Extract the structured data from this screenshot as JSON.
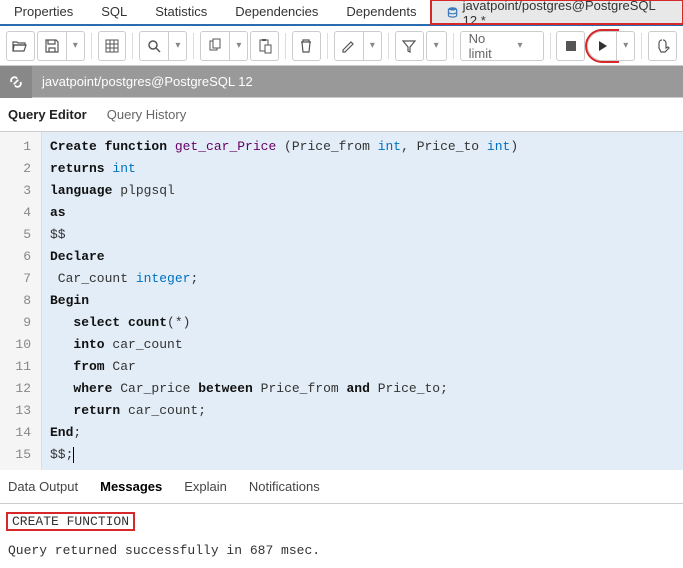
{
  "topTabs": {
    "properties": "Properties",
    "sql": "SQL",
    "statistics": "Statistics",
    "dependencies": "Dependencies",
    "dependents": "Dependents",
    "activeTab": "javatpoint/postgres@PostgreSQL 12 *"
  },
  "toolbar": {
    "limit": "No limit"
  },
  "connection": {
    "label": "javatpoint/postgres@PostgreSQL 12"
  },
  "editorTabs": {
    "queryEditor": "Query Editor",
    "queryHistory": "Query History"
  },
  "code": {
    "lines": [
      {
        "n": "1",
        "segs": [
          [
            "kw",
            "Create function"
          ],
          [
            "fn",
            " get_car_Price"
          ],
          [
            "op",
            " ("
          ],
          [
            "op",
            "Price_from "
          ],
          [
            "ty",
            "int"
          ],
          [
            "op",
            ", Price_to "
          ],
          [
            "ty",
            "int"
          ],
          [
            "op",
            ")"
          ]
        ]
      },
      {
        "n": "2",
        "segs": [
          [
            "kw",
            "returns"
          ],
          [
            "op",
            " "
          ],
          [
            "ty",
            "int"
          ]
        ]
      },
      {
        "n": "3",
        "segs": [
          [
            "kw",
            "language"
          ],
          [
            "op",
            " plpgsql"
          ]
        ]
      },
      {
        "n": "4",
        "segs": [
          [
            "kw",
            "as"
          ]
        ]
      },
      {
        "n": "5",
        "segs": [
          [
            "op",
            "$$"
          ]
        ]
      },
      {
        "n": "6",
        "segs": [
          [
            "kw",
            "Declare"
          ]
        ]
      },
      {
        "n": "7",
        "segs": [
          [
            "op",
            " Car_count "
          ],
          [
            "ty",
            "integer"
          ],
          [
            "op",
            ";"
          ]
        ]
      },
      {
        "n": "8",
        "segs": [
          [
            "kw",
            "Begin"
          ]
        ]
      },
      {
        "n": "9",
        "segs": [
          [
            "op",
            "   "
          ],
          [
            "kw",
            "select"
          ],
          [
            "op",
            " "
          ],
          [
            "kw",
            "count"
          ],
          [
            "op",
            "("
          ],
          [
            "op",
            "*"
          ],
          [
            "op",
            ")"
          ]
        ]
      },
      {
        "n": "10",
        "segs": [
          [
            "op",
            "   "
          ],
          [
            "kw",
            "into"
          ],
          [
            "op",
            " car_count"
          ]
        ]
      },
      {
        "n": "11",
        "segs": [
          [
            "op",
            "   "
          ],
          [
            "kw",
            "from"
          ],
          [
            "op",
            " Car"
          ]
        ]
      },
      {
        "n": "12",
        "segs": [
          [
            "op",
            "   "
          ],
          [
            "kw",
            "where"
          ],
          [
            "op",
            " Car_price "
          ],
          [
            "kw",
            "between"
          ],
          [
            "op",
            " Price_from "
          ],
          [
            "kw",
            "and"
          ],
          [
            "op",
            " Price_to;"
          ]
        ]
      },
      {
        "n": "13",
        "segs": [
          [
            "op",
            "   "
          ],
          [
            "kw",
            "return"
          ],
          [
            "op",
            " car_count;"
          ]
        ]
      },
      {
        "n": "14",
        "segs": [
          [
            "kw",
            "End"
          ],
          [
            "op",
            ";"
          ]
        ]
      },
      {
        "n": "15",
        "segs": [
          [
            "op",
            "$$;"
          ]
        ]
      }
    ]
  },
  "outputTabs": {
    "dataOutput": "Data Output",
    "messages": "Messages",
    "explain": "Explain",
    "notifications": "Notifications"
  },
  "messages": {
    "result": "CREATE FUNCTION",
    "status": "Query returned successfully in 687 msec."
  }
}
